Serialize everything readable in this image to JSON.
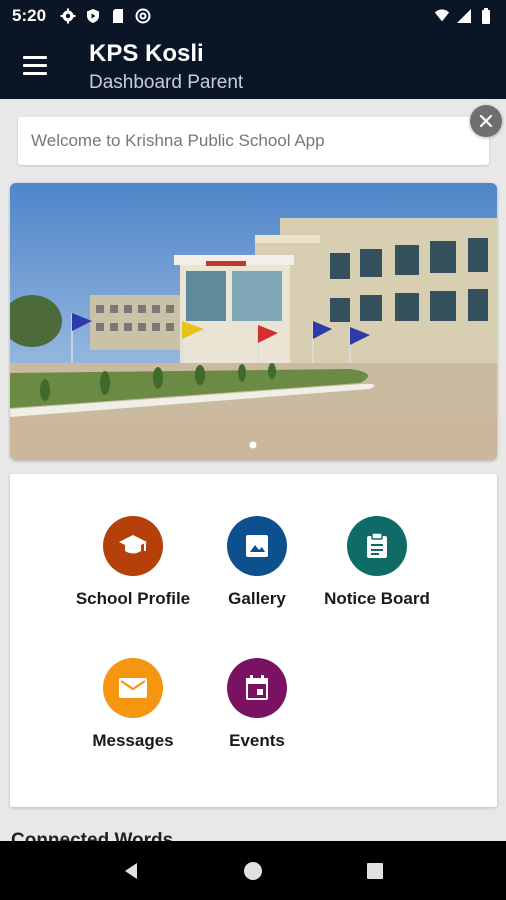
{
  "status_bar": {
    "time": "5:20",
    "left_icons": [
      "gear-icon",
      "shield-play-icon",
      "sd-card-icon",
      "at-sign-icon"
    ],
    "right_icons": [
      "wifi-icon",
      "cell-signal-icon",
      "battery-icon"
    ]
  },
  "app_bar": {
    "title": "KPS Kosli",
    "subtitle": "Dashboard Parent",
    "background": "#0a1526"
  },
  "welcome": {
    "text": "Welcome to Krishna Public School App"
  },
  "banner": {
    "slide_count": 1,
    "active_slide": 0
  },
  "menu": {
    "items": [
      {
        "label": "School Profile",
        "icon": "graduation-cap-icon",
        "color": "#b5400a"
      },
      {
        "label": "Gallery",
        "icon": "image-icon",
        "color": "#0e4f8e"
      },
      {
        "label": "Notice Board",
        "icon": "notice-icon",
        "color": "#0e6b66"
      },
      {
        "label": "Messages",
        "icon": "mail-icon",
        "color": "#f6950f"
      },
      {
        "label": "Events",
        "icon": "calendar-icon",
        "color": "#7b1163"
      }
    ]
  },
  "section": {
    "title": "Connected Words"
  },
  "nav_bar": {
    "buttons": [
      "back-icon",
      "home-icon",
      "recents-icon"
    ]
  }
}
